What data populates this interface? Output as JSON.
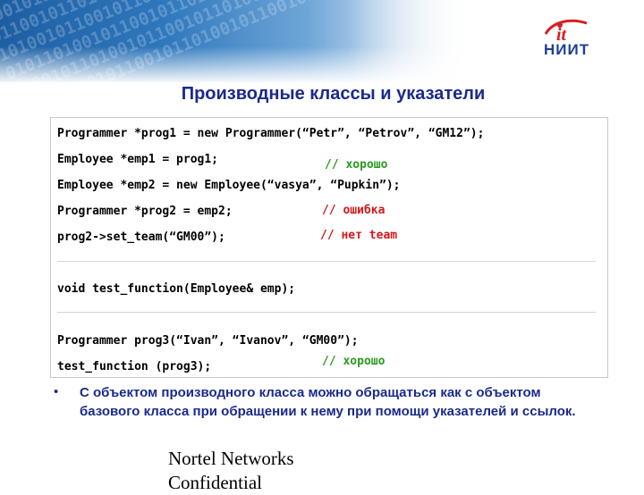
{
  "slide": {
    "title": "Производные классы и указатели",
    "logo_text": "НИИТ",
    "logo_mark": "it",
    "code_lines": [
      "Programmer *prog1 = new Programmer(“Petr”, “Petrov”, “GM12”);",
      "Employee *emp1 = prog1;",
      "Employee *emp2 = new Employee(“vasya”, “Pupkin”);",
      "Programmer *prog2 = emp2;",
      "prog2->set_team(“GM00”);",
      "void test_function(Employee& emp);",
      "Programmer prog3(“Ivan”, “Ivanov”, “GM00”);",
      "test_function (prog3);"
    ],
    "comments": [
      {
        "text": "// хорошо",
        "status": "ok"
      },
      {
        "text": "// ошибка",
        "status": "error"
      },
      {
        "text": "// нет team",
        "status": "error"
      },
      {
        "text": "// хорошо",
        "status": "ok"
      }
    ],
    "bullet": "С объектом производного класса можно обращаться как с объектом базового класса при обращении к нему при помощи указателей и ссылок.",
    "footer_line1": "Nortel Networks",
    "footer_line2": "Confidential",
    "colors": {
      "title": "#1a2a8c",
      "ok_comment": "#2a9a1f",
      "error_comment": "#d41818"
    }
  }
}
